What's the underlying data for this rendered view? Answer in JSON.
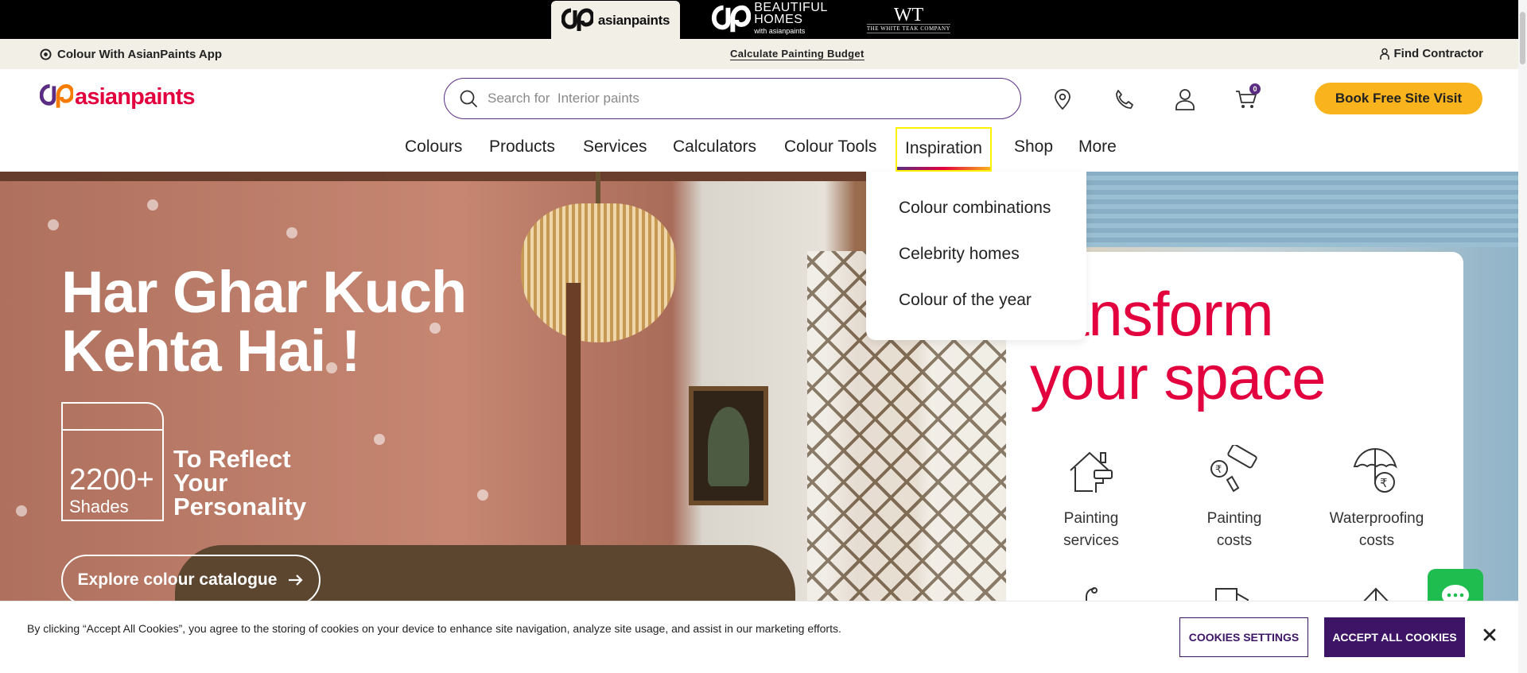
{
  "brand_strip": {
    "tabs": [
      {
        "name": "asianpaints"
      },
      {
        "name": "BEAUTIFUL HOMES",
        "line1": "BEAUTIFUL",
        "line2": "HOMES",
        "sub": "with asianpaints"
      },
      {
        "name": "THE WHITE TEAK COMPANY",
        "mono": "WT",
        "sub": "THE WHITE TEAK COMPANY"
      }
    ]
  },
  "utility_bar": {
    "app_link": "Colour With AsianPaints App",
    "budget_link": "Calculate Painting Budget",
    "contractor_link": "Find Contractor"
  },
  "header": {
    "logo_text": "asianpaints",
    "search": {
      "placeholder": "Search for  Interior paints"
    },
    "icons": [
      "location-icon",
      "phone-icon",
      "user-icon",
      "cart-icon"
    ],
    "cart_count": "0",
    "cta": "Book Free Site Visit"
  },
  "nav": {
    "items": [
      {
        "label": "Colours"
      },
      {
        "label": "Products"
      },
      {
        "label": "Services"
      },
      {
        "label": "Calculators"
      },
      {
        "label": "Colour Tools"
      },
      {
        "label": "Inspiration",
        "active": true
      },
      {
        "label": "Shop"
      },
      {
        "label": "More"
      }
    ],
    "dropdown": {
      "items": [
        {
          "label": "Colour combinations"
        },
        {
          "label": "Celebrity homes"
        },
        {
          "label": "Colour of the year"
        }
      ]
    }
  },
  "hero": {
    "title_line1": "Har Ghar Kuch",
    "title_line2": "Kehta Hai !",
    "shades_count": "2200+",
    "shades_label": "Shades",
    "tagline_line1": "To Reflect",
    "tagline_line2": "Your",
    "tagline_line3": "Personality",
    "cta": "Explore colour catalogue"
  },
  "transform_card": {
    "title_line1": "ansform",
    "title_line2": "your space",
    "services": [
      {
        "line1": "Painting",
        "line2": "services",
        "icon": "house-roller-icon"
      },
      {
        "line1": "Painting",
        "line2": "costs",
        "icon": "rupee-roller-icon"
      },
      {
        "line1": "Waterproofing",
        "line2": "costs",
        "icon": "umbrella-rupee-icon"
      }
    ]
  },
  "cookie_bar": {
    "text": "By clicking “Accept All Cookies”, you agree to the storing of cookies on your device to enhance site navigation, analyze site usage, and assist in our marketing efforts.",
    "settings_label": "COOKIES SETTINGS",
    "accept_label": "ACCEPT ALL COOKIES"
  },
  "colors": {
    "brand_red": "#e3003f",
    "brand_purple": "#5a2d82",
    "cta_yellow": "#f9b31c",
    "cookie_purple": "#3d1466",
    "chat_green": "#1fbd4f"
  }
}
